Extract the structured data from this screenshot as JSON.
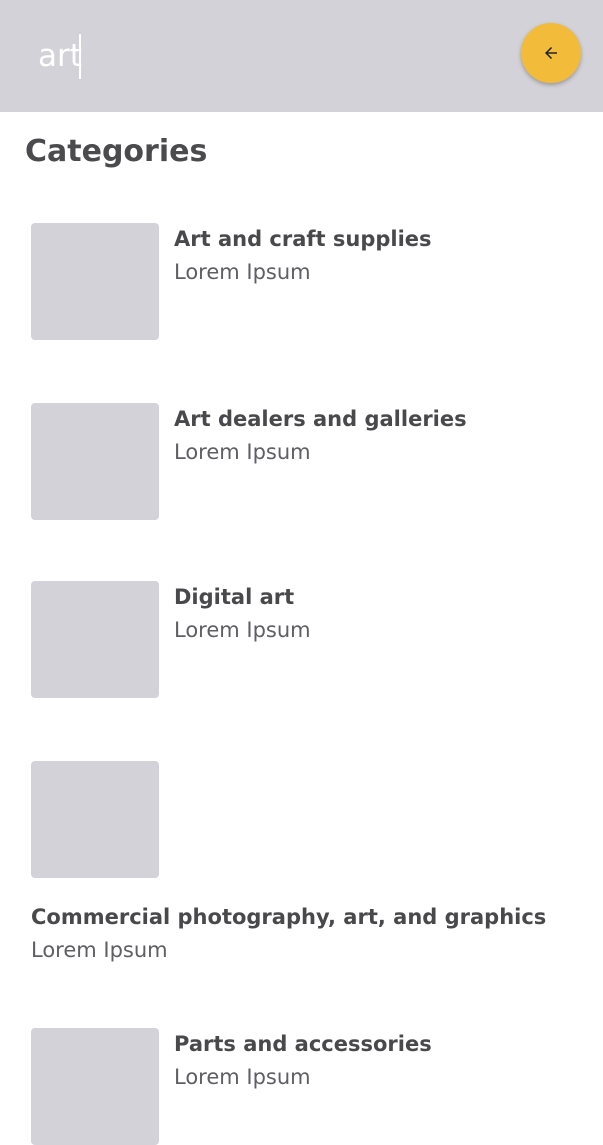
{
  "search": {
    "value": "art",
    "back_icon": "arrow-left-icon",
    "accent_color": "#f2bb3a",
    "header_color": "#d3d2d8"
  },
  "section": {
    "title": "Categories"
  },
  "categories": [
    {
      "title": "Art and craft supplies",
      "subtitle": "Lorem Ipsum"
    },
    {
      "title": "Art dealers and galleries",
      "subtitle": "Lorem Ipsum"
    },
    {
      "title": "Digital art",
      "subtitle": "Lorem Ipsum"
    },
    {
      "title": "Commercial photography, art, and graphics",
      "subtitle": "Lorem Ipsum"
    },
    {
      "title": "Parts and accessories",
      "subtitle": "Lorem Ipsum"
    }
  ]
}
